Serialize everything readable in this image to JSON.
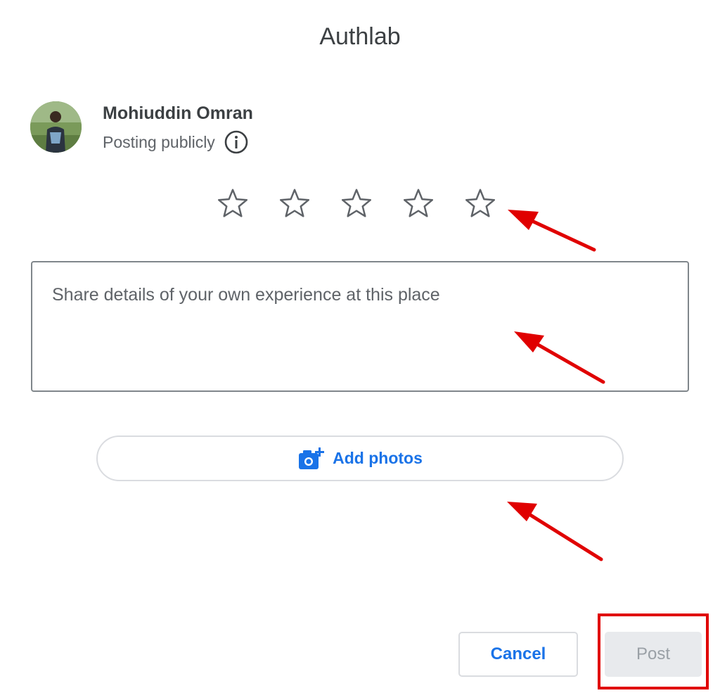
{
  "header": {
    "title": "Authlab"
  },
  "user": {
    "name": "Mohiuddin Omran",
    "posting_status": "Posting publicly",
    "avatar_icon": "avatar-photo",
    "info_icon": "info-icon"
  },
  "rating": {
    "max_stars": 5,
    "selected": 0,
    "star_icon": "star-outline-icon"
  },
  "review": {
    "placeholder": "Share details of your own experience at this place",
    "value": ""
  },
  "photos": {
    "add_label": "Add photos",
    "icon": "add-photo-camera-icon"
  },
  "actions": {
    "cancel_label": "Cancel",
    "post_label": "Post"
  },
  "colors": {
    "accent": "#1a73e8",
    "annotation": "#e00000",
    "disabled_bg": "#e8eaed",
    "disabled_text": "#9aa0a6"
  }
}
